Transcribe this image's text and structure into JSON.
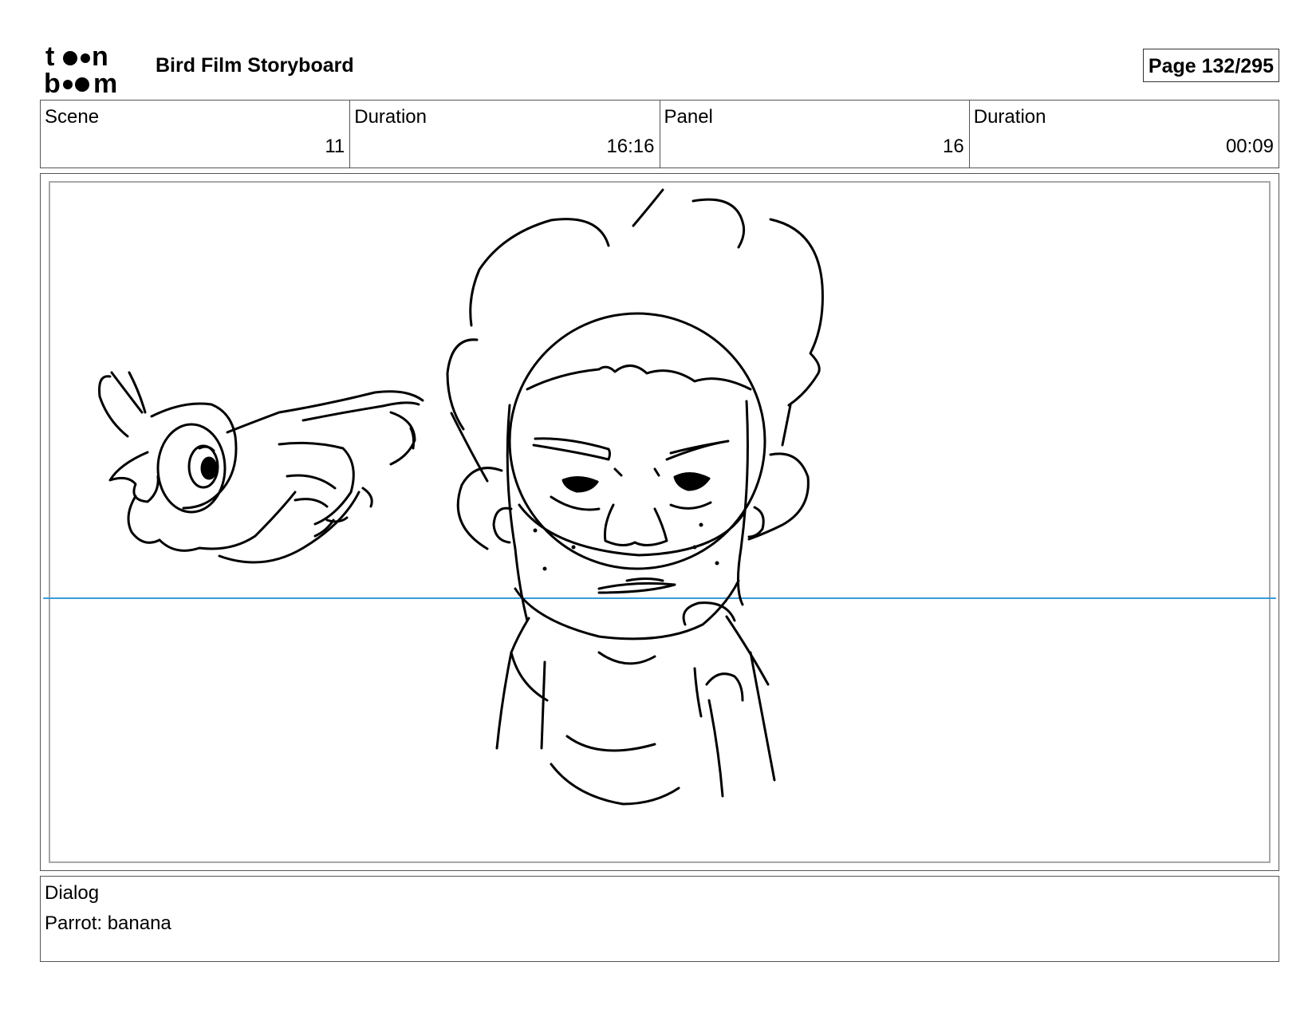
{
  "header": {
    "logo_text": "toonboom",
    "title": "Bird Film Storyboard",
    "page": "Page 132/295"
  },
  "info": {
    "scene_label": "Scene",
    "scene_value": "11",
    "scene_duration_label": "Duration",
    "scene_duration_value": "16:16",
    "panel_label": "Panel",
    "panel_value": "16",
    "panel_duration_label": "Duration",
    "panel_duration_value": "00:09"
  },
  "panel": {
    "icon": "storyboard-sketch",
    "horizon_color": "#3a9ad9"
  },
  "dialog": {
    "label": "Dialog",
    "text": "Parrot: banana"
  }
}
